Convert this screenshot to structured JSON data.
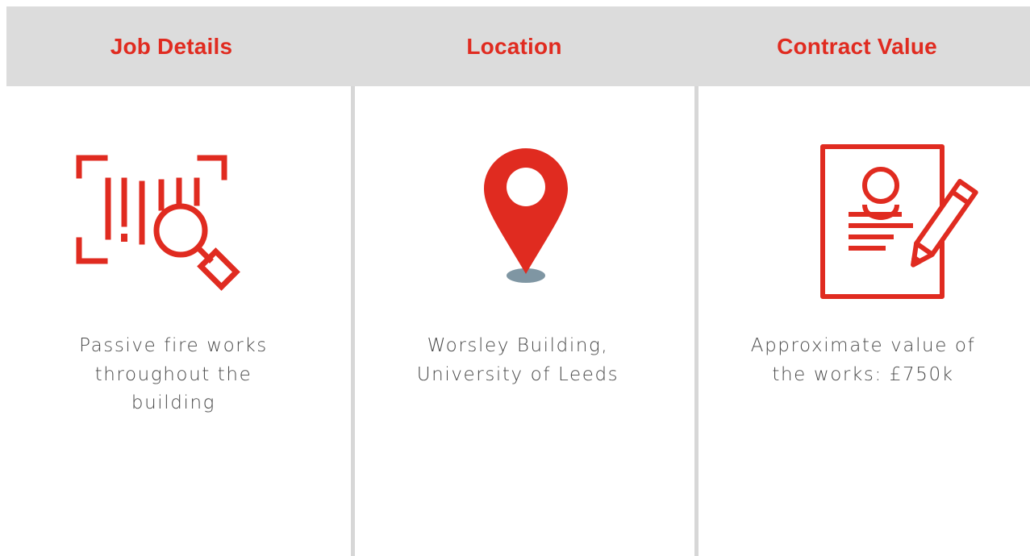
{
  "columns": [
    {
      "header": "Job Details",
      "icon": "barcode-search-icon",
      "description": "Passive fire works throughout the building"
    },
    {
      "header": "Location",
      "icon": "map-pin-icon",
      "description": "Worsley Building, University of Leeds"
    },
    {
      "header": "Contract Value",
      "icon": "contract-pen-icon",
      "description": "Approximate value of the works: £750k"
    }
  ],
  "colors": {
    "accent": "#e02b20",
    "header_bg": "#dcdcdc",
    "divider": "#d7d7d7",
    "text": "#4a4a4a",
    "pin_shadow": "#7f96a3"
  }
}
